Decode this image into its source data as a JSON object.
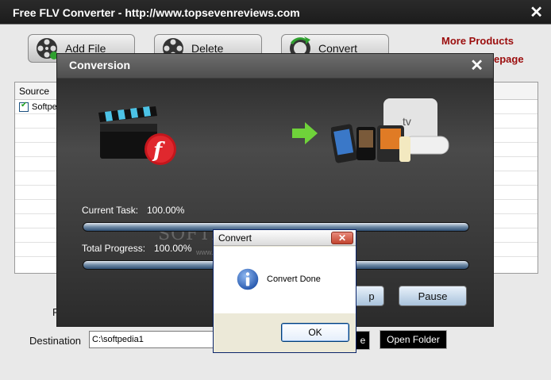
{
  "main_window": {
    "title": "Free FLV Converter - http://www.topsevenreviews.com",
    "toolbar": {
      "add_file_label": "Add File",
      "delete_label": "Delete",
      "convert_label": "Convert"
    },
    "links": {
      "more_products": "More Products",
      "homepage_partial": "epage"
    },
    "list": {
      "column_source": "Source",
      "rows": [
        {
          "checked": true,
          "source": "Softpe"
        }
      ]
    },
    "profile_label_partial": "P",
    "destination_label": "Destination",
    "destination_value": "C:\\softpedia1",
    "browse_partial": "e",
    "open_folder_label": "Open Folder"
  },
  "conversion_dialog": {
    "title": "Conversion",
    "current_task_label": "Current Task:",
    "current_task_value": "100.00%",
    "current_task_progress": 1.0,
    "total_progress_label": "Total Progress:",
    "total_progress_value": "100.00%",
    "total_progress": 1.0,
    "stop_partial": "p",
    "pause_label": "Pause",
    "watermark": "SOFTPEDIA",
    "watermark_sub": "www.softpedia.com",
    "devices_tv_label": "tv"
  },
  "message_box": {
    "title": "Convert",
    "message": "Convert Done",
    "ok_label": "OK",
    "close_glyph": "✕",
    "icon": "info-icon"
  },
  "colors": {
    "title_bar": "#1c1c1c",
    "link_red": "#9b0d0d",
    "progress_blue": "#4a6d94"
  }
}
